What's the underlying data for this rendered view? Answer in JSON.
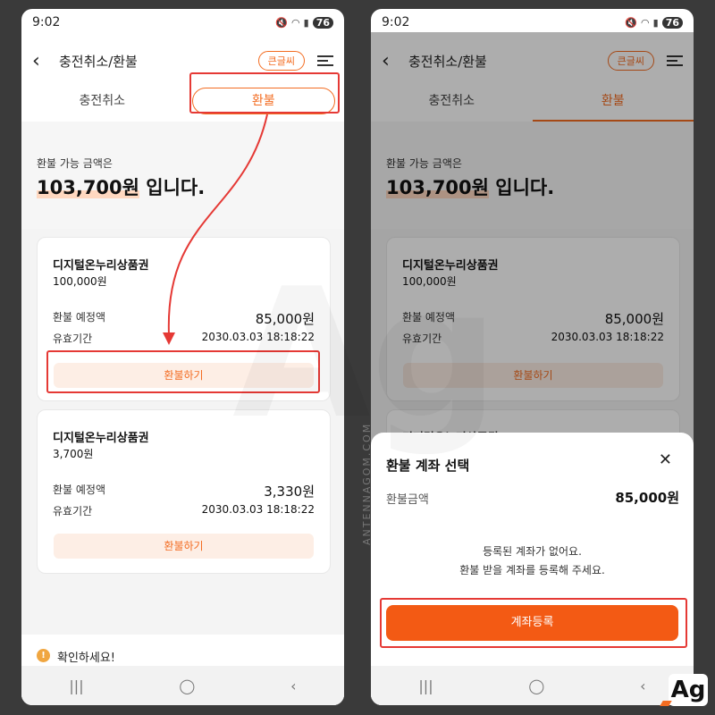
{
  "status": {
    "time": "9:02",
    "battery": "76"
  },
  "header": {
    "title": "충전취소/환불",
    "big_text_button": "큰글씨"
  },
  "tabs": {
    "cancel": "충전취소",
    "refund": "환불"
  },
  "refund_summary": {
    "label": "환불 가능 금액은",
    "amount": "103,700원",
    "suffix": " 입니다."
  },
  "cards": [
    {
      "name": "디지털온누리상품권",
      "face_value": "100,000원",
      "expected_label": "환불 예정액",
      "expected_amount": "85,000원",
      "expiry_label": "유효기간",
      "expiry": "2030.03.03 18:18:22",
      "button": "환불하기"
    },
    {
      "name": "디지털온누리상품권",
      "face_value": "3,700원",
      "expected_label": "환불 예정액",
      "expected_amount": "3,330원",
      "expiry_label": "유효기간",
      "expiry": "2030.03.03 18:18:22",
      "button": "환불하기"
    }
  ],
  "notice": {
    "text": "확인하세요!",
    "icon": "info-icon"
  },
  "sheet": {
    "title": "환불 계좌 선택",
    "amount_label": "환불금액",
    "amount": "85,000원",
    "message_line1": "등록된 계좌가 없어요.",
    "message_line2": "환불 받을 계좌를 등록해 주세요.",
    "button": "계좌등록"
  },
  "branding": {
    "vertical": "ANTENNAGOM.COM",
    "logo": "Ag",
    "watermark": "Ag"
  },
  "colors": {
    "accent": "#f36c21",
    "highlight": "#e53935",
    "button": "#f35a14"
  }
}
